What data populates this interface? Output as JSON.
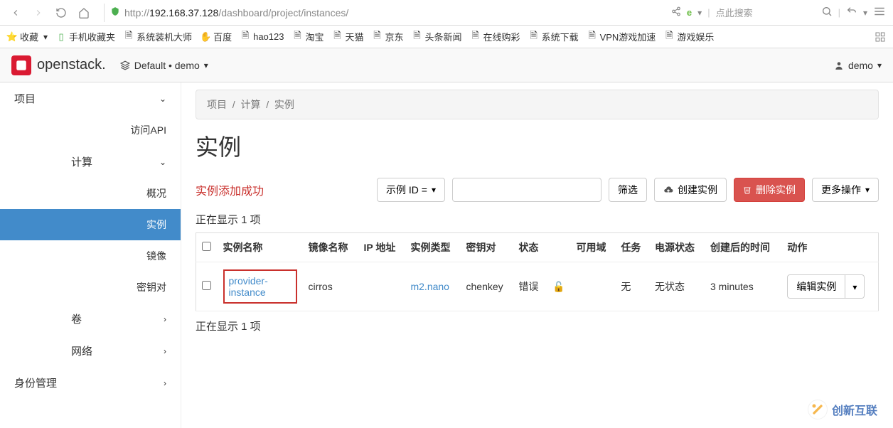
{
  "browser": {
    "url_protocol": "http://",
    "url_host": "192.168.37.128",
    "url_path": "/dashboard/project/instances/",
    "search_placeholder": "点此搜索"
  },
  "bookmarks": {
    "fav": "收藏",
    "mobile": "手机收藏夹",
    "items": [
      "系统装机大师",
      "百度",
      "hao123",
      "淘宝",
      "天猫",
      "京东",
      "头条新闻",
      "在线购彩",
      "系统下载",
      "VPN游戏加速",
      "游戏娱乐"
    ]
  },
  "openstack": {
    "logo": "openstack.",
    "project_label": "Default • demo",
    "user": "demo"
  },
  "sidebar": {
    "project": "项目",
    "api": "访问API",
    "compute": "计算",
    "overview": "概况",
    "instances": "实例",
    "images": "镜像",
    "keypairs": "密钥对",
    "volumes": "卷",
    "network": "网络",
    "identity": "身份管理"
  },
  "breadcrumb": {
    "project": "项目",
    "compute": "计算",
    "instances": "实例"
  },
  "page": {
    "title": "实例",
    "success_msg": "实例添加成功",
    "filter_field": "示例 ID =",
    "filter_button": "筛选",
    "create_button": "创建实例",
    "delete_button": "删除实例",
    "more_actions": "更多操作",
    "showing": "正在显示 1 项",
    "edit_button": "编辑实例"
  },
  "table": {
    "headers": {
      "name": "实例名称",
      "image": "镜像名称",
      "ip": "IP 地址",
      "flavor": "实例类型",
      "keypair": "密钥对",
      "status": "状态",
      "zone": "可用域",
      "task": "任务",
      "power": "电源状态",
      "age": "创建后的时间",
      "actions": "动作"
    },
    "rows": [
      {
        "name": "provider-instance",
        "image": "cirros",
        "ip": "",
        "flavor": "m2.nano",
        "keypair": "chenkey",
        "status": "错误",
        "zone": "",
        "task": "无",
        "power": "无状态",
        "age": "3 minutes"
      }
    ]
  },
  "watermark": "创新互联"
}
